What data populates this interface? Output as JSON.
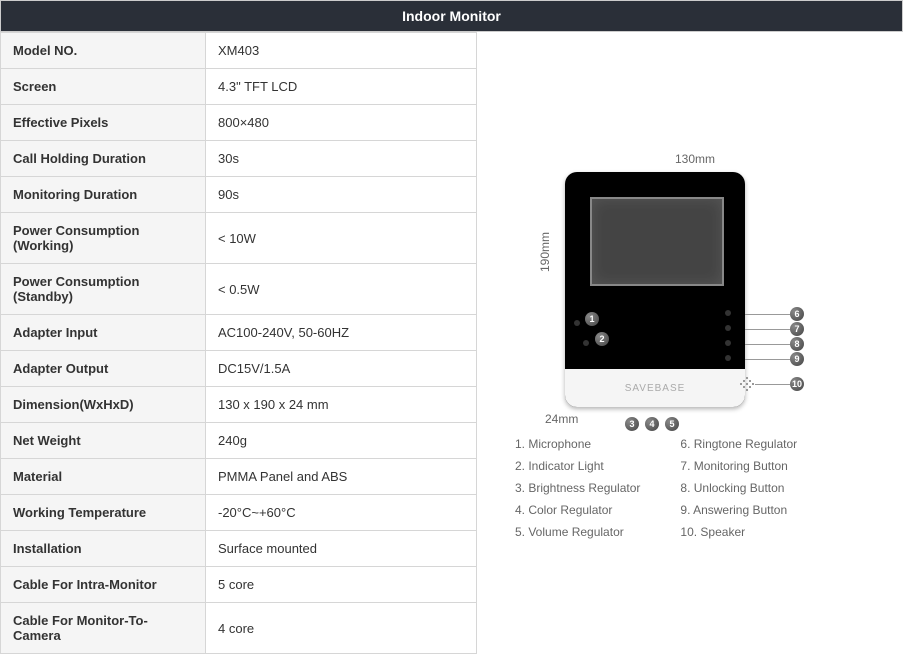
{
  "header": "Indoor Monitor",
  "specs": [
    {
      "label": "Model NO.",
      "value": "XM403"
    },
    {
      "label": "Screen",
      "value": "4.3\" TFT LCD"
    },
    {
      "label": "Effective Pixels",
      "value": "800×480"
    },
    {
      "label": "Call Holding Duration",
      "value": "30s"
    },
    {
      "label": "Monitoring Duration",
      "value": "90s"
    },
    {
      "label": "Power Consumption (Working)",
      "value": "< 10W"
    },
    {
      "label": "Power Consumption (Standby)",
      "value": "< 0.5W"
    },
    {
      "label": "Adapter Input",
      "value": "AC100-240V, 50-60HZ"
    },
    {
      "label": "Adapter Output",
      "value": "DC15V/1.5A"
    },
    {
      "label": "Dimension(WxHxD)",
      "value": "130 x 190 x 24 mm"
    },
    {
      "label": "Net Weight",
      "value": "240g"
    },
    {
      "label": "Material",
      "value": "PMMA Panel and ABS"
    },
    {
      "label": "Working Temperature",
      "value": "-20°C~+60°C"
    },
    {
      "label": "Installation",
      "value": "Surface mounted"
    },
    {
      "label": "Cable For Intra-Monitor",
      "value": "5 core"
    },
    {
      "label": "Cable For Monitor-To-Camera",
      "value": "4 core"
    }
  ],
  "dimensions": {
    "width": "130mm",
    "height": "190mm",
    "depth": "24mm"
  },
  "watermark": "SAVEBASE",
  "callouts": [
    "1",
    "2",
    "3",
    "4",
    "5",
    "6",
    "7",
    "8",
    "9",
    "10"
  ],
  "legend_left": [
    "1. Microphone",
    "2. Indicator Light",
    "3. Brightness Regulator",
    "4. Color Regulator",
    "5. Volume Regulator"
  ],
  "legend_right": [
    "6. Ringtone Regulator",
    "7. Monitoring Button",
    "8. Unlocking Button",
    "9. Answering Button",
    "10. Speaker"
  ]
}
